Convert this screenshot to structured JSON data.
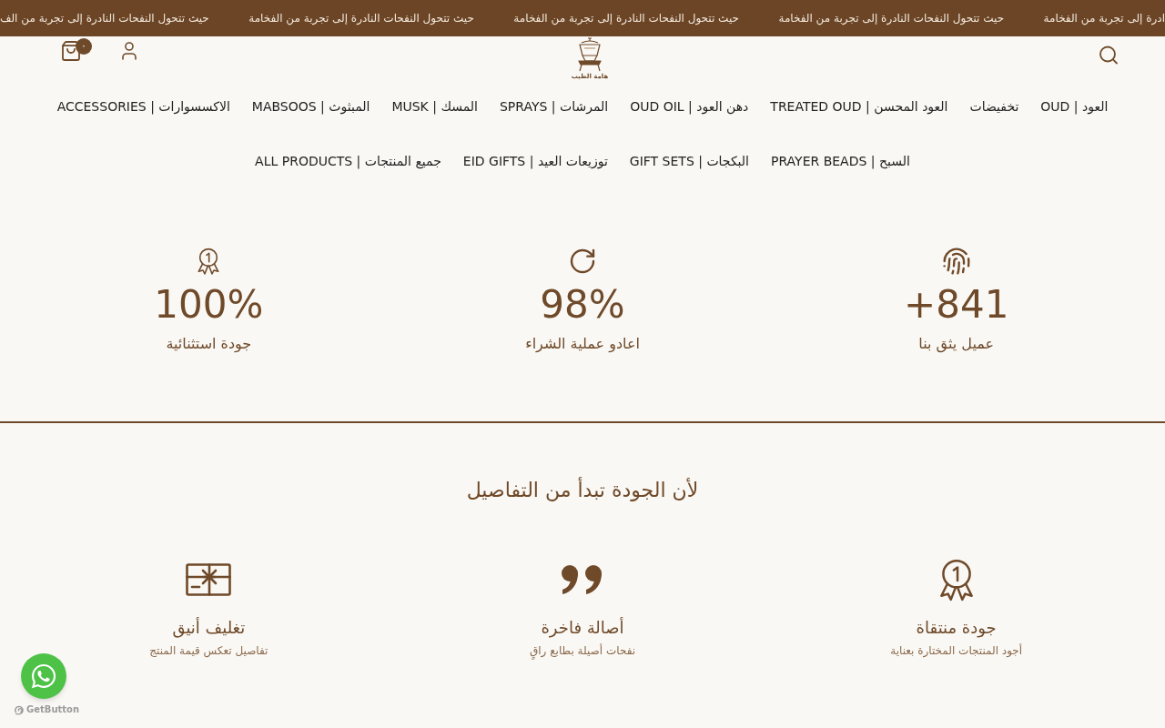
{
  "announcement_bar": {
    "items": [
      "ادرة إلى تجربة من الفخامة",
      "حيث تتحول النفحات النادرة إلى تجربة من الفخامة",
      "حيث تتحول النفحات النادرة إلى تجربة من الفخامة",
      "حيث تتحول النفحات النادرة إلى تجربة من الفخامة",
      "حيث تتحول النفحات النادرة إلى تجربة من الف"
    ]
  },
  "header": {
    "logo": {
      "name": "هامة الطيب"
    },
    "cart": {
      "count": "٠"
    }
  },
  "nav": {
    "rows": [
      {
        "items": [
          {
            "label": "العود | OUD"
          },
          {
            "label": "تخفيضات"
          },
          {
            "label": "العود المحسن | TREATED OUD"
          },
          {
            "label": "دهن العود | OUD OIL"
          },
          {
            "label": "المرشات | SPRAYS"
          },
          {
            "label": "المسك | MUSK"
          },
          {
            "label": "المبثوث | MABSOOS"
          },
          {
            "label": "الاكسسوارات | ACCESSORIES"
          }
        ]
      },
      {
        "items": [
          {
            "label": "السبح | PRAYER BEADS"
          },
          {
            "label": "البكجات | GIFT SETS"
          },
          {
            "label": "توزيعات العيد | EID GIFTS"
          },
          {
            "label": "جميع المنتجات | ALL PRODUCTS"
          }
        ]
      }
    ]
  },
  "stats": [
    {
      "value": "+841",
      "label": "عميل يثق بنا"
    },
    {
      "value": "98%",
      "label": "اعادو عملية الشراء"
    },
    {
      "value": "100%",
      "label": "جودة استثنائية"
    }
  ],
  "features": {
    "title": "لأن الجودة تبدأ من التفاصيل",
    "items": [
      {
        "title": "جودة منتقاة",
        "description": "أجود المنتجات المختارة بعناية"
      },
      {
        "title": "أصالة فاخرة",
        "description": "نفحات أصيلة بطابع راقٍ"
      },
      {
        "title": "تغليف أنيق",
        "description": "تفاصيل تعكس قيمة المنتج"
      }
    ]
  },
  "chat_widget": {
    "label": "GetButton"
  }
}
